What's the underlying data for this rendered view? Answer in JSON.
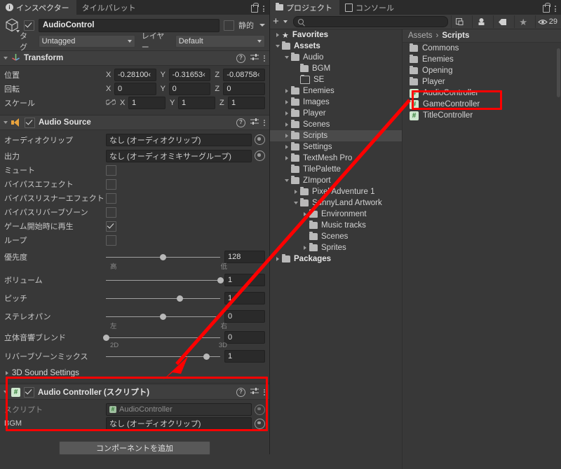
{
  "accent": {
    "red": "#ff0000",
    "tab_blue": "#2c5d87",
    "script_green": "#2e7d32",
    "audio_orange": "#e8a33d"
  },
  "inspector": {
    "tabs": [
      {
        "label": "インスペクター",
        "icon": "info-icon",
        "active": true
      },
      {
        "label": "タイルパレット",
        "icon": "",
        "active": false
      }
    ],
    "lock_icon": "lock-open-icon",
    "menu_icon": "kebab-menu-icon",
    "gameobject": {
      "enabled": true,
      "name": "AudioControl",
      "static_label": "静的",
      "static_checked": false,
      "tag_label": "タグ",
      "tag_value": "Untagged",
      "layer_label": "レイヤー",
      "layer_value": "Default"
    },
    "components": [
      {
        "title": "Transform",
        "icon": "transform-axis-icon",
        "has_checkbox": false,
        "expanded": true,
        "rows": [
          {
            "label": "位置",
            "axes": [
              {
                "axis": "X",
                "value": "-0.28100‹"
              },
              {
                "axis": "Y",
                "value": "-0.31653‹"
              },
              {
                "axis": "Z",
                "value": "-0.08758‹"
              }
            ]
          },
          {
            "label": "回転",
            "axes": [
              {
                "axis": "X",
                "value": "0"
              },
              {
                "axis": "Y",
                "value": "0"
              },
              {
                "axis": "Z",
                "value": "0"
              }
            ]
          },
          {
            "label": "スケール",
            "link_icon": "link-broken-icon",
            "axes": [
              {
                "axis": "X",
                "value": "1"
              },
              {
                "axis": "Y",
                "value": "1"
              },
              {
                "axis": "Z",
                "value": "1"
              }
            ]
          }
        ]
      },
      {
        "title": "Audio Source",
        "icon": "speaker-icon",
        "has_checkbox": true,
        "checked": true,
        "expanded": true,
        "object_fields": [
          {
            "label": "オーディオクリップ",
            "value": "なし (オーディオクリップ)"
          },
          {
            "label": "出力",
            "value": "なし (オーディオミキサーグループ)"
          }
        ],
        "toggles": [
          {
            "label": "ミュート",
            "checked": false
          },
          {
            "label": "バイパスエフェクト",
            "checked": false
          },
          {
            "label": "バイパスリスナーエフェクト",
            "checked": false
          },
          {
            "label": "バイパスリバーブゾーン",
            "checked": false
          },
          {
            "label": "ゲーム開始時に再生",
            "checked": true
          },
          {
            "label": "ループ",
            "checked": false
          }
        ],
        "sliders": [
          {
            "label": "優先度",
            "value": "128",
            "pos": 50,
            "min_label": "高",
            "max_label": "低"
          },
          {
            "label": "ボリューム",
            "value": "1",
            "pos": 100,
            "min_label": "",
            "max_label": ""
          },
          {
            "label": "ピッチ",
            "value": "1",
            "pos": 65,
            "min_label": "",
            "max_label": ""
          },
          {
            "label": "ステレオパン",
            "value": "0",
            "pos": 50,
            "min_label": "左",
            "max_label": "右"
          },
          {
            "label": "立体音響ブレンド",
            "value": "0",
            "pos": 0,
            "min_label": "2D",
            "max_label": "3D"
          },
          {
            "label": "リバーブゾーンミックス",
            "value": "1",
            "pos": 88,
            "min_label": "",
            "max_label": ""
          }
        ],
        "foldout": "3D Sound Settings"
      },
      {
        "title": "Audio Controller (スクリプト)",
        "icon": "script-icon",
        "has_checkbox": true,
        "checked": true,
        "expanded": true,
        "highlighted": true,
        "rows": [
          {
            "label": "スクリプト",
            "value": "AudioController",
            "dim": true
          },
          {
            "label": "BGM",
            "value": "なし (オーディオクリップ)",
            "dim": false
          }
        ]
      }
    ],
    "add_component_label": "コンポーネントを追加"
  },
  "project": {
    "tabs": [
      {
        "label": "プロジェクト",
        "icon": "folder-icon",
        "active": true
      },
      {
        "label": "コンソール",
        "icon": "console-icon",
        "active": false
      }
    ],
    "lock_icon": "lock-open-icon",
    "menu_icon": "kebab-menu-icon",
    "toolbar": {
      "add_label": "+",
      "search_placeholder": "",
      "icons": [
        "save-search-icon",
        "filter-type-icon",
        "filter-label-icon",
        "favorite-star-icon",
        "visibility-eye-icon"
      ],
      "visibility_count": "29"
    },
    "tree": [
      {
        "label": "Favorites",
        "depth": 0,
        "icon": "star-icon",
        "arrow": "closed",
        "bold": true
      },
      {
        "label": "Assets",
        "depth": 0,
        "icon": "folder-open-icon",
        "arrow": "open",
        "bold": true
      },
      {
        "label": "Audio",
        "depth": 1,
        "icon": "folder-open-icon",
        "arrow": "open"
      },
      {
        "label": "BGM",
        "depth": 2,
        "icon": "folder-icon",
        "arrow": "none"
      },
      {
        "label": "SE",
        "depth": 2,
        "icon": "folder-empty-icon",
        "arrow": "none"
      },
      {
        "label": "Enemies",
        "depth": 1,
        "icon": "folder-icon",
        "arrow": "closed"
      },
      {
        "label": "Images",
        "depth": 1,
        "icon": "folder-icon",
        "arrow": "closed"
      },
      {
        "label": "Player",
        "depth": 1,
        "icon": "folder-icon",
        "arrow": "closed"
      },
      {
        "label": "Scenes",
        "depth": 1,
        "icon": "folder-icon",
        "arrow": "closed"
      },
      {
        "label": "Scripts",
        "depth": 1,
        "icon": "folder-icon",
        "arrow": "closed",
        "selected": true
      },
      {
        "label": "Settings",
        "depth": 1,
        "icon": "folder-icon",
        "arrow": "closed"
      },
      {
        "label": "TextMesh Pro",
        "depth": 1,
        "icon": "folder-icon",
        "arrow": "closed"
      },
      {
        "label": "TilePalette",
        "depth": 1,
        "icon": "folder-icon",
        "arrow": "none"
      },
      {
        "label": "ZImport",
        "depth": 1,
        "icon": "folder-open-icon",
        "arrow": "open"
      },
      {
        "label": "Pixel Adventure 1",
        "depth": 2,
        "icon": "folder-icon",
        "arrow": "closed"
      },
      {
        "label": "SunnyLand Artwork",
        "depth": 2,
        "icon": "folder-open-icon",
        "arrow": "open"
      },
      {
        "label": "Environment",
        "depth": 3,
        "icon": "folder-icon",
        "arrow": "closed"
      },
      {
        "label": "Music tracks",
        "depth": 3,
        "icon": "folder-icon",
        "arrow": "none"
      },
      {
        "label": "Scenes",
        "depth": 3,
        "icon": "folder-icon",
        "arrow": "none"
      },
      {
        "label": "Sprites",
        "depth": 3,
        "icon": "folder-icon",
        "arrow": "closed"
      },
      {
        "label": "Packages",
        "depth": 0,
        "icon": "folder-icon",
        "arrow": "closed",
        "bold": true
      }
    ],
    "breadcrumb": {
      "root": "Assets",
      "separator": "›",
      "current": "Scripts"
    },
    "items": [
      {
        "label": "Commons",
        "type": "folder"
      },
      {
        "label": "Enemies",
        "type": "folder"
      },
      {
        "label": "Opening",
        "type": "folder"
      },
      {
        "label": "Player",
        "type": "folder"
      },
      {
        "label": "AudioController",
        "type": "script",
        "highlighted": true
      },
      {
        "label": "GameController",
        "type": "script"
      },
      {
        "label": "TitleController",
        "type": "script"
      }
    ]
  },
  "annotations": {
    "arrow": {
      "from": "AudioController asset in project list",
      "to": "Audio Controller script component in inspector",
      "color": "#ff0000"
    },
    "boxes": [
      "audio-controller-component",
      "audio-controller-asset"
    ]
  }
}
